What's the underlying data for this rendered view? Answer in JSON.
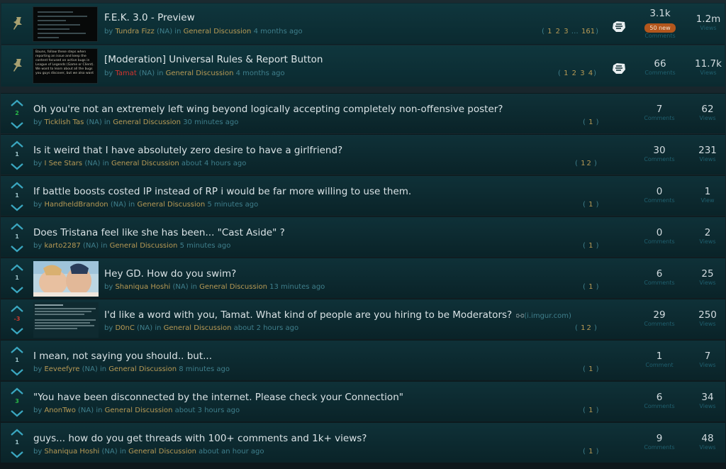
{
  "pinned": [
    {
      "title": "F.E.K. 3.0 - Preview",
      "by": "by",
      "author": "Tundra Fizz",
      "region": "(NA)",
      "in": "in",
      "category": "General Discussion",
      "time": "4 months ago",
      "pages": [
        "1",
        "2",
        "3",
        "…",
        "161"
      ],
      "comments": "3.1k",
      "comments_label": "Comments",
      "new_badge": "50 new",
      "views": "1.2m",
      "views_label": "Views"
    },
    {
      "title": "[Moderation] Universal Rules & Report Button",
      "by": "by",
      "author": "Tamat",
      "region": "(NA)",
      "in": "in",
      "category": "General Discussion",
      "time": "4 months ago",
      "pages": [
        "1",
        "2",
        "3",
        "4"
      ],
      "comments": "66",
      "comments_label": "Comments",
      "views": "11.7k",
      "views_label": "Views",
      "thumb_text": "Bauns, follow these steps when reporting an issue and keep the content focused on active bugs in League of Legends (Game or Client). We want to learn about all the bugs you guys discover, but we also want"
    }
  ],
  "threads": [
    {
      "score": "2",
      "title": "Oh you're not an extremely left wing beyond logically accepting completely non-offensive poster?",
      "by": "by",
      "author": "Ticklish Tas",
      "region": "(NA)",
      "in": "in",
      "category": "General Discussion",
      "time": "30 minutes ago",
      "pages": [
        "1"
      ],
      "comments": "7",
      "comments_label": "Comments",
      "views": "62",
      "views_label": "Views"
    },
    {
      "score": "1",
      "title": "Is it weird that I have absolutely zero desire to have a girlfriend?",
      "by": "by",
      "author": "I See Stars",
      "region": "(NA)",
      "in": "in",
      "category": "General Discussion",
      "time": "about 4 hours ago",
      "pages": [
        "1",
        "2"
      ],
      "comments": "30",
      "comments_label": "Comments",
      "views": "231",
      "views_label": "Views"
    },
    {
      "score": "1",
      "title": "If battle boosts costed IP instead of RP i would be far more willing to use them.",
      "by": "by",
      "author": "HandheldBrandon",
      "region": "(NA)",
      "in": "in",
      "category": "General Discussion",
      "time": "5 minutes ago",
      "pages": [
        "1"
      ],
      "comments": "0",
      "comments_label": "Comments",
      "views": "1",
      "views_label": "View"
    },
    {
      "score": "1",
      "title": "Does Tristana feel like she has been... \"Cast Aside\" ?",
      "by": "by",
      "author": "karto2287",
      "region": "(NA)",
      "in": "in",
      "category": "General Discussion",
      "time": "5 minutes ago",
      "pages": [
        "1"
      ],
      "comments": "0",
      "comments_label": "Comments",
      "views": "2",
      "views_label": "Views"
    },
    {
      "score": "1",
      "title": "Hey GD. How do you swim?",
      "by": "by",
      "author": "Shaniqua Hoshi",
      "region": "(NA)",
      "in": "in",
      "category": "General Discussion",
      "time": "13 minutes ago",
      "pages": [
        "1"
      ],
      "comments": "6",
      "comments_label": "Comments",
      "views": "25",
      "views_label": "Views"
    },
    {
      "score": "-3",
      "title": "I'd like a word with you, Tamat. What kind of people are you hiring to be Moderators?",
      "link": "(i.imgur.com)",
      "by": "by",
      "author": "D0nC",
      "region": "(NA)",
      "in": "in",
      "category": "General Discussion",
      "time": "about 2 hours ago",
      "pages": [
        "1",
        "2"
      ],
      "comments": "29",
      "comments_label": "Comments",
      "views": "250",
      "views_label": "Views"
    },
    {
      "score": "1",
      "title": "I mean, not saying you should.. but...",
      "by": "by",
      "author": "Eeveefyre",
      "region": "(NA)",
      "in": "in",
      "category": "General Discussion",
      "time": "8 minutes ago",
      "pages": [
        "1"
      ],
      "comments": "1",
      "comments_label": "Comment",
      "views": "7",
      "views_label": "Views"
    },
    {
      "score": "3",
      "title": "\"You have been disconnected by the internet. Please check your Connection\"",
      "by": "by",
      "author": "AnonTwo",
      "region": "(NA)",
      "in": "in",
      "category": "General Discussion",
      "time": "about 3 hours ago",
      "pages": [
        "1"
      ],
      "comments": "6",
      "comments_label": "Comments",
      "views": "34",
      "views_label": "Views"
    },
    {
      "score": "1",
      "title": "guys... how do you get threads with 100+ comments and 1k+ views?",
      "by": "by",
      "author": "Shaniqua Hoshi",
      "region": "(NA)",
      "in": "in",
      "category": "General Discussion",
      "time": "about an hour ago",
      "pages": [
        "1"
      ],
      "comments": "9",
      "comments_label": "Comments",
      "views": "48",
      "views_label": "Views"
    }
  ],
  "colors": {
    "author": "#b79a55",
    "moderator_author": "#d2332e",
    "meta": "#3f7f8c",
    "score_positive": "#29b948",
    "score_negative": "#cf3a2e",
    "new_badge": "#b3561c"
  },
  "icons": {
    "pin": "pin-icon",
    "riot_staff": "riot-fist-icon",
    "upvote": "chevron-up-icon",
    "downvote": "chevron-down-icon",
    "link": "link-icon"
  }
}
